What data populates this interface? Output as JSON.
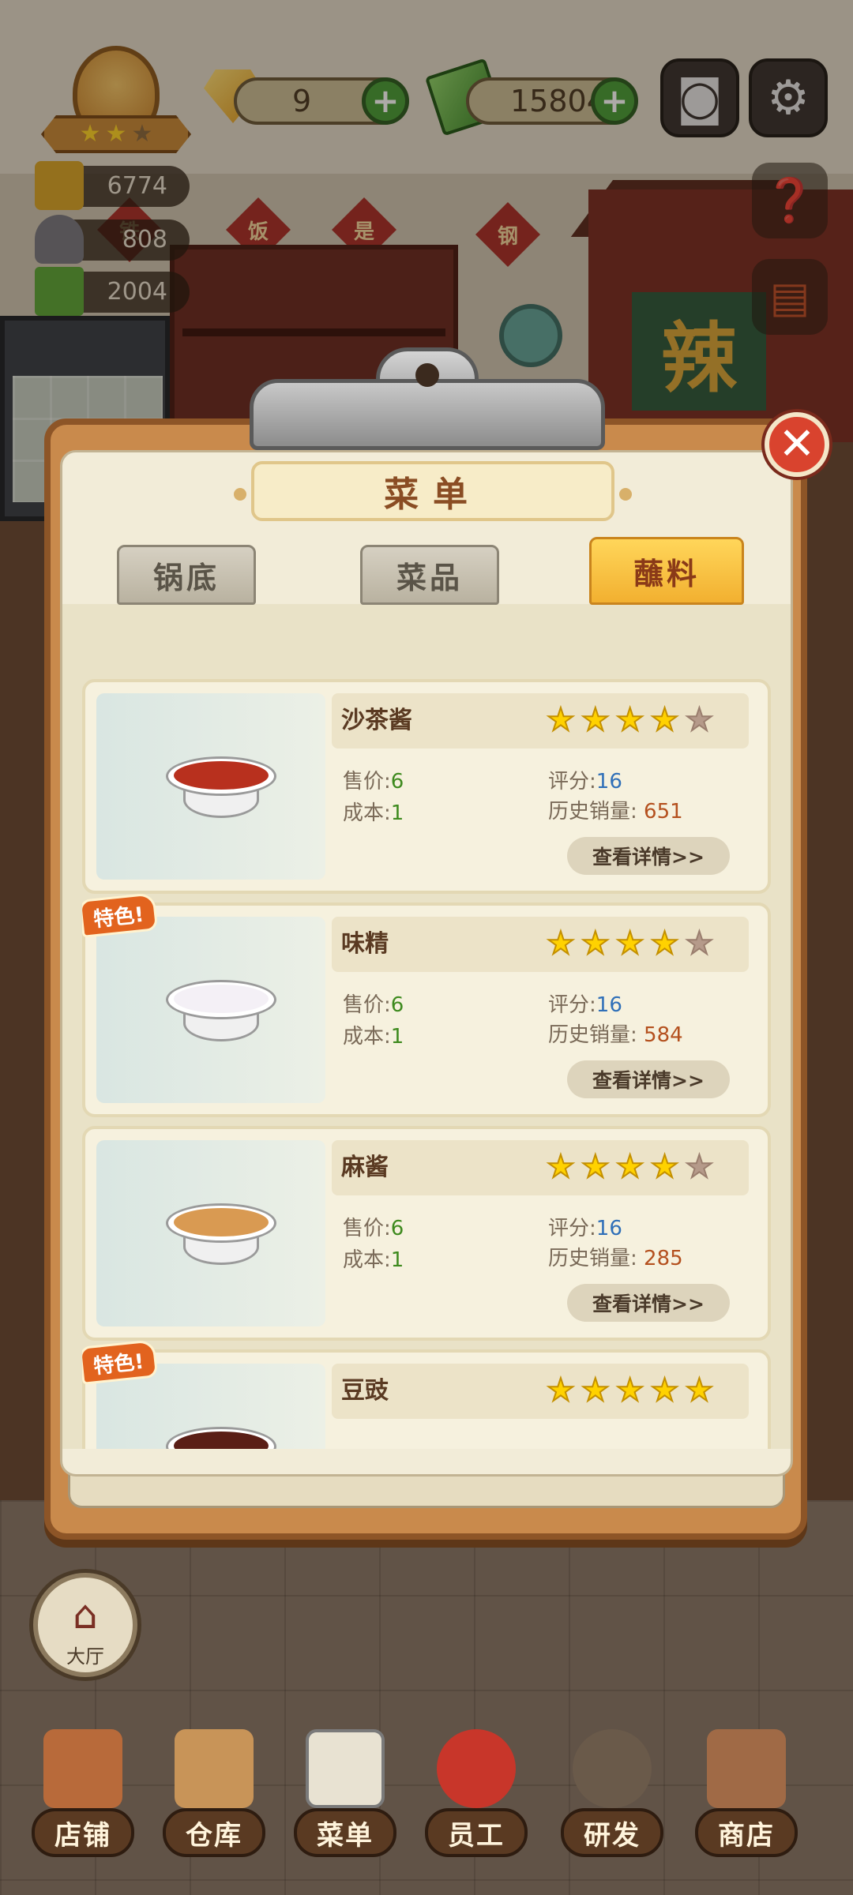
{
  "hud": {
    "gems": "9",
    "cash": "15804",
    "stats": [
      "6774",
      "808",
      "2004"
    ],
    "badge_stars": [
      true,
      true,
      false
    ]
  },
  "background_signs": [
    "铁",
    "饭",
    "是",
    "钢"
  ],
  "gate_sign": "辣",
  "menu": {
    "title": "菜单",
    "tabs": [
      {
        "label": "锅底",
        "active": false
      },
      {
        "label": "菜品",
        "active": false
      },
      {
        "label": "蘸料",
        "active": true
      }
    ],
    "price_label": "售价",
    "cost_label": "成本",
    "score_label": "评分",
    "sales_label": "历史销量",
    "detail_label": "查看详情>>",
    "special_label": "特色!",
    "items": [
      {
        "name": "沙茶酱",
        "stars": 4,
        "price": "6",
        "cost": "1",
        "score": "16",
        "sales": "651",
        "special": false,
        "fill": "#b8301e"
      },
      {
        "name": "味精",
        "stars": 4,
        "price": "6",
        "cost": "1",
        "score": "16",
        "sales": "584",
        "special": true,
        "fill": "#f4f0f6"
      },
      {
        "name": "麻酱",
        "stars": 4,
        "price": "6",
        "cost": "1",
        "score": "16",
        "sales": "285",
        "special": false,
        "fill": "#d99a52"
      },
      {
        "name": "豆豉",
        "stars": 5,
        "price": "",
        "cost": "",
        "score": "",
        "sales": "",
        "special": true,
        "fill": "#5a1e16"
      }
    ]
  },
  "hall_label": "大厅",
  "nav": [
    "店铺",
    "仓库",
    "菜单",
    "员工",
    "研发",
    "商店"
  ],
  "colors": {
    "accent": "#f2b030",
    "close": "#d9432e",
    "board": "#c98a4c"
  }
}
